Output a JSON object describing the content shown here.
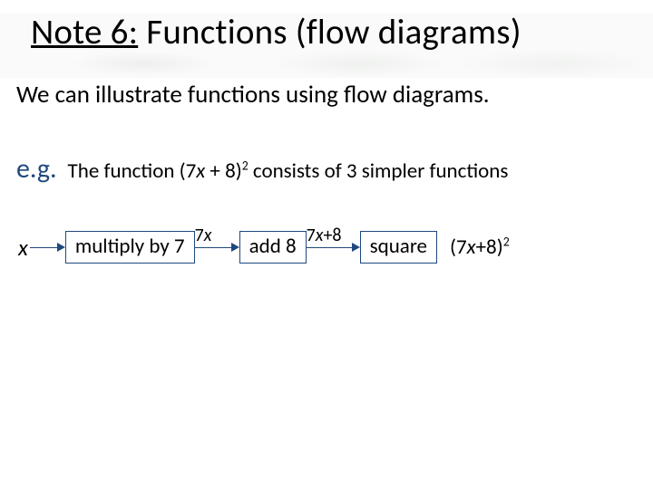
{
  "title": {
    "underlined": "Note 6:",
    "rest": "  Functions (flow diagrams)"
  },
  "intro": "We can illustrate functions using flow diagrams.",
  "example": {
    "label": "e.g.",
    "pre": "The function  (7",
    "var1": "x",
    "mid": " + 8)",
    "exp": "2",
    "post": "  consists of 3 simpler functions"
  },
  "flow": {
    "input": "x",
    "box1": "multiply by 7",
    "label1_pre": "7",
    "label1_var": "x",
    "box2": "add 8",
    "label2_pre": "7",
    "label2_var": "x",
    "label2_post": "+8",
    "box3": "square",
    "result_pre": "(7",
    "result_var": "x",
    "result_post": "+8)",
    "result_exp": "2"
  }
}
